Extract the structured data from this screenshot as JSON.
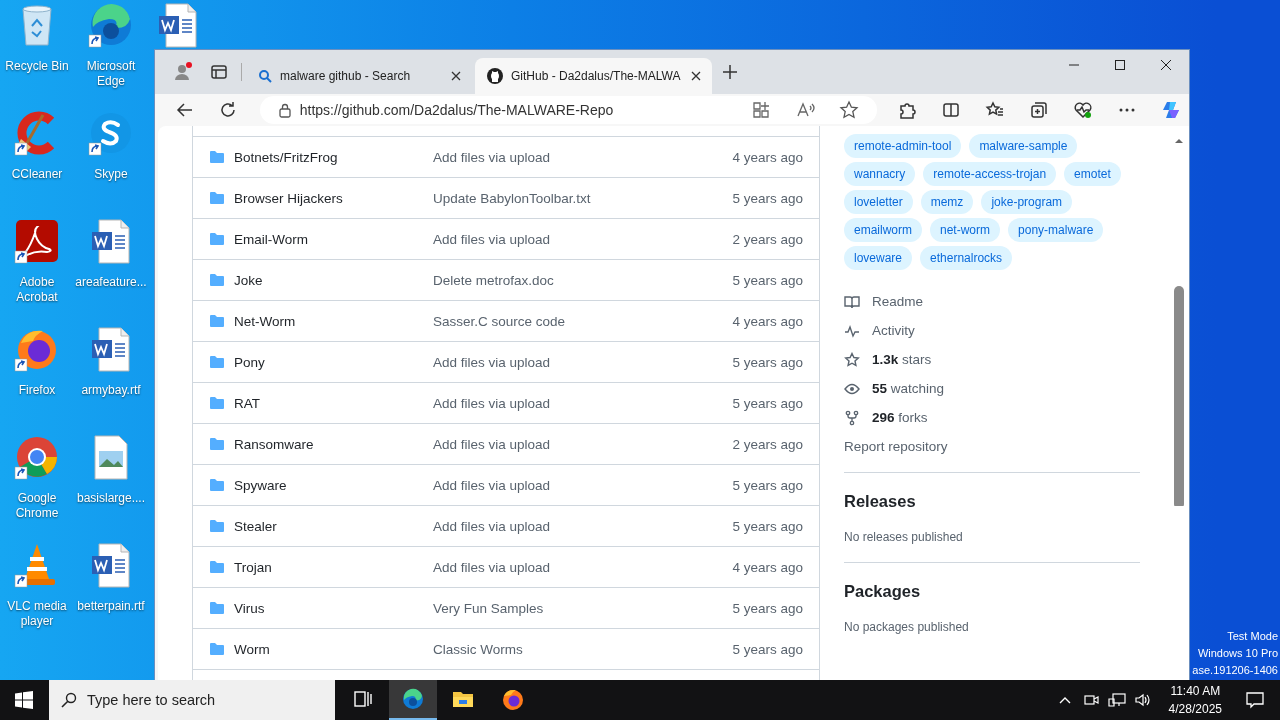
{
  "desktop": {
    "icons": [
      {
        "kind": "recycle",
        "label": "Recycle Bin",
        "shortcut": false
      },
      {
        "kind": "edge",
        "label": "Microsoft Edge",
        "shortcut": true
      },
      {
        "kind": "word",
        "shortcut": false
      },
      {
        "kind": "ccleaner",
        "label": "CCleaner",
        "shortcut": true
      },
      {
        "kind": "skype",
        "label": "Skype",
        "shortcut": true
      },
      {
        "kind": "blank"
      },
      {
        "kind": "acrobat",
        "label": "Adobe Acrobat",
        "shortcut": true
      },
      {
        "kind": "word",
        "label": "areafeature...",
        "shortcut": false
      },
      {
        "kind": "blank"
      },
      {
        "kind": "firefox",
        "label": "Firefox",
        "shortcut": true
      },
      {
        "kind": "word",
        "label": "armybay.rtf",
        "shortcut": false
      },
      {
        "kind": "blank"
      },
      {
        "kind": "chrome",
        "label": "Google Chrome",
        "shortcut": true
      },
      {
        "kind": "image",
        "label": "basislarge....",
        "shortcut": false
      },
      {
        "kind": "blank"
      },
      {
        "kind": "vlc",
        "label": "VLC media player",
        "shortcut": true
      },
      {
        "kind": "word",
        "label": "betterpain.rtf",
        "shortcut": false
      }
    ],
    "os_info": [
      "Test Mode",
      "Windows 10 Pro",
      "ase.191206-1406"
    ]
  },
  "browser": {
    "tabs": [
      {
        "kind": "search",
        "title": "malware github - Search",
        "selected": false
      },
      {
        "kind": "github",
        "title": "GitHub - Da2dalus/The-MALWA",
        "selected": true
      }
    ],
    "url": "https://github.com/Da2dalus/The-MALWARE-Repo"
  },
  "files": [
    {
      "name": "Botnets/FritzFrog",
      "message": "Add files via upload",
      "age": "4 years ago"
    },
    {
      "name": "Browser Hijackers",
      "message": "Update BabylonToolbar.txt",
      "age": "5 years ago"
    },
    {
      "name": "Email-Worm",
      "message": "Add files via upload",
      "age": "2 years ago"
    },
    {
      "name": "Joke",
      "message": "Delete metrofax.doc",
      "age": "5 years ago"
    },
    {
      "name": "Net-Worm",
      "message": "Sasser.C source code",
      "age": "4 years ago"
    },
    {
      "name": "Pony",
      "message": "Add files via upload",
      "age": "5 years ago"
    },
    {
      "name": "RAT",
      "message": "Add files via upload",
      "age": "5 years ago"
    },
    {
      "name": "Ransomware",
      "message": "Add files via upload",
      "age": "2 years ago"
    },
    {
      "name": "Spyware",
      "message": "Add files via upload",
      "age": "5 years ago"
    },
    {
      "name": "Stealer",
      "message": "Add files via upload",
      "age": "5 years ago"
    },
    {
      "name": "Trojan",
      "message": "Add files via upload",
      "age": "4 years ago"
    },
    {
      "name": "Virus",
      "message": "Very Fun Samples",
      "age": "5 years ago"
    },
    {
      "name": "Worm",
      "message": "Classic Worms",
      "age": "5 years ago"
    }
  ],
  "sidebar": {
    "topics": [
      [
        "remote-admin-tool",
        "malware-sample"
      ],
      [
        "wannacry",
        "remote-access-trojan",
        "emotet"
      ],
      [
        "loveletter",
        "memz",
        "joke-program"
      ],
      [
        "emailworm",
        "net-worm",
        "pony-malware"
      ],
      [
        "loveware",
        "ethernalrocks"
      ]
    ],
    "links": [
      {
        "kind": "readme",
        "label": "Readme"
      },
      {
        "kind": "activity",
        "label": "Activity"
      },
      {
        "kind": "stars",
        "label": "**1.3k** stars"
      },
      {
        "kind": "watching",
        "label": "**55** watching"
      },
      {
        "kind": "forks",
        "label": "**296** forks"
      },
      {
        "kind": "report",
        "label": "Report repository"
      }
    ],
    "sections": [
      {
        "title": "Releases",
        "note": "No releases published"
      },
      {
        "title": "Packages",
        "note": "No packages published"
      }
    ]
  },
  "taskbar": {
    "search_placeholder": "Type here to search",
    "apps": [
      {
        "kind": "taskview",
        "selected": false
      },
      {
        "kind": "edge",
        "selected": true
      },
      {
        "kind": "explorer",
        "selected": false
      },
      {
        "kind": "firefox",
        "selected": false
      }
    ],
    "time": "11:40 AM",
    "date": "4/28/2025"
  }
}
